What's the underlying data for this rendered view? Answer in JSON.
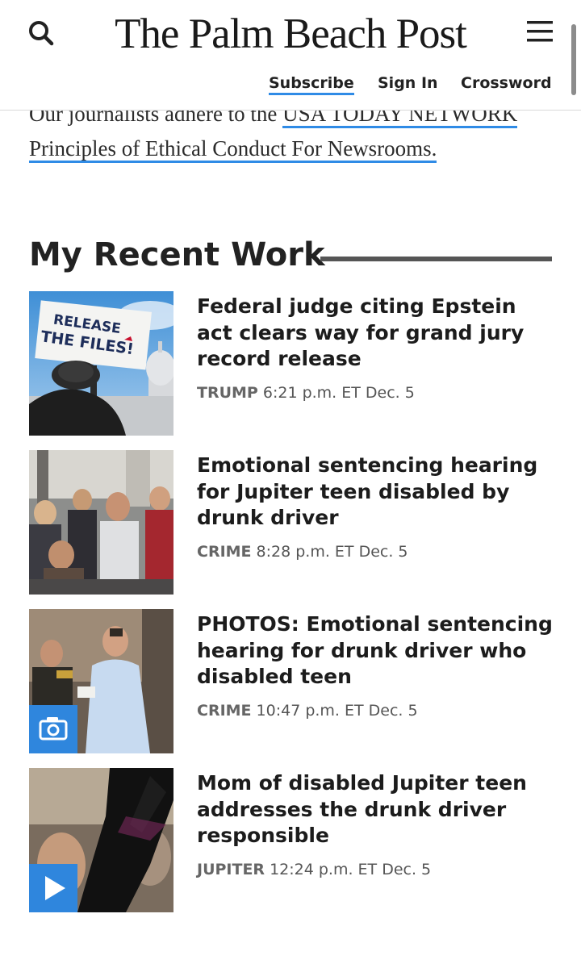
{
  "header": {
    "masthead": "The Palm Beach Post",
    "search_icon": "search-icon",
    "menu_icon": "hamburger-menu-icon",
    "nav": {
      "subscribe": "Subscribe",
      "sign_in": "Sign In",
      "crossword": "Crossword"
    }
  },
  "ethics": {
    "text_before": "Our journalists adhere to the ",
    "link_text": "USA TODAY NETWORK Principles of Ethical Conduct For Newsrooms."
  },
  "section": {
    "title": "My Recent Work"
  },
  "articles": [
    {
      "headline": "Federal judge citing Epstein act clears way for grand jury record release",
      "tag": "TRUMP",
      "time": "6:21 p.m. ET Dec. 5",
      "media": "none",
      "sign_line1": "RELEASE",
      "sign_line2": "THE FILES!"
    },
    {
      "headline": "Emotional sentencing hearing for Jupiter teen disabled by drunk driver",
      "tag": "CRIME",
      "time": "8:28 p.m. ET Dec. 5",
      "media": "none"
    },
    {
      "headline": "PHOTOS: Emotional sentencing hearing for drunk driver who disabled teen",
      "tag": "CRIME",
      "time": "10:47 p.m. ET Dec. 5",
      "media": "camera-icon"
    },
    {
      "headline": "Mom of disabled Jupiter teen addresses the drunk driver responsible",
      "tag": "JUPITER",
      "time": "12:24 p.m. ET Dec. 5",
      "media": "play-icon"
    }
  ],
  "colors": {
    "accent_link": "#2f8be6",
    "media_badge": "#2f86dd",
    "heading_rule": "#555555"
  }
}
